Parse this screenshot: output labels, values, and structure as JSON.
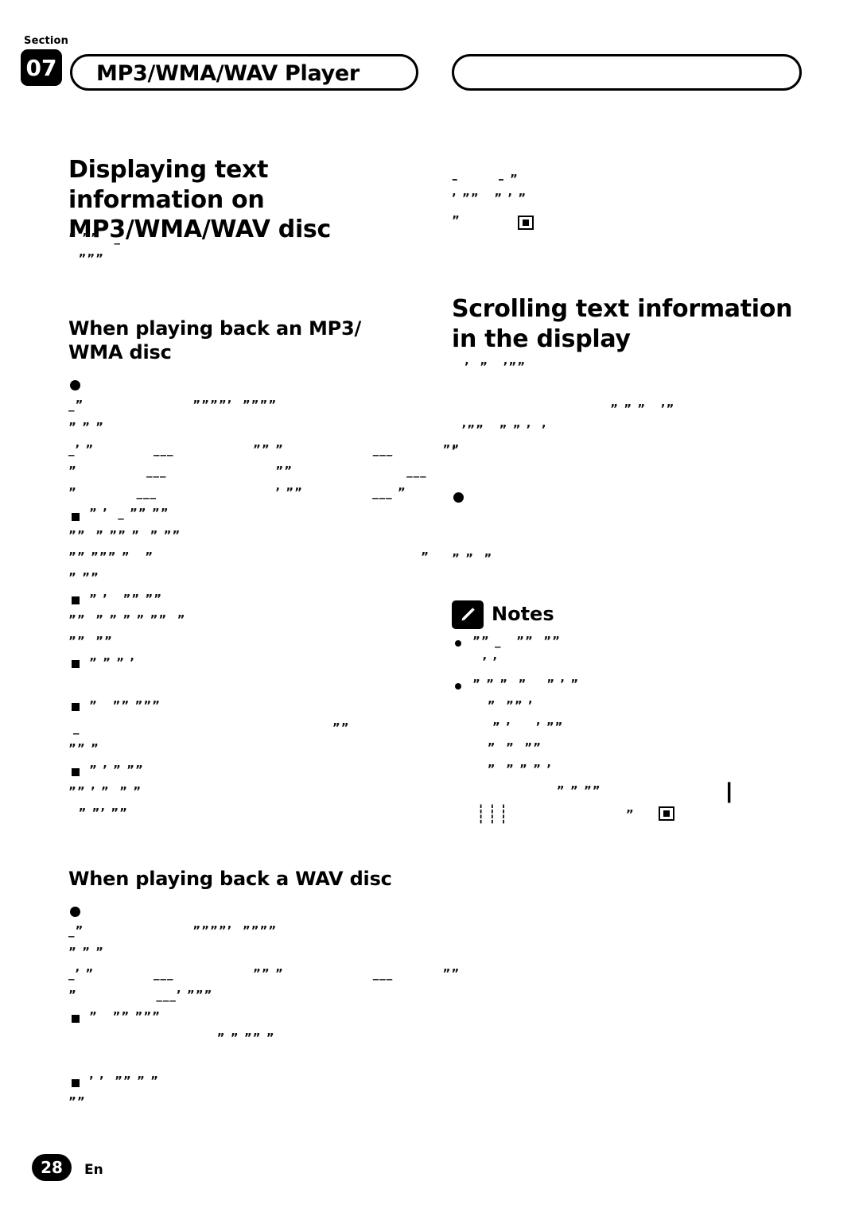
{
  "page": {
    "section_label": "Section",
    "section_number": "07",
    "chapter_title": "MP3/WMA/WAV Player",
    "page_number": "28",
    "language_code": "En"
  },
  "left_column": {
    "heading": "Displaying text information on MP3/WMA/WAV disc",
    "intro_lines": [
      "” ””   _",
      "  ”””"
    ],
    "subheading_1": "When playing back an MP3/ WMA disc",
    "body_1": [
      "_”                      ””””’  ””””",
      "” ” ”",
      "_’ ”            ___                ”” ”                  ___          ””",
      "”              ___                      ””                       ___",
      "”            ___                        ’ ””              ___ ”"
    ],
    "body_2": [
      "” ’  _ ”” ””",
      "””  ” ”” ”  ” ””",
      "”” ””” ”   ”                                                      ”",
      "” ””"
    ],
    "body_3": [
      "” ’   ”” ””",
      "””  ” ” ” ” ””  ”",
      "””  ””"
    ],
    "body_4": [
      "” ” ” ’"
    ],
    "body_5": [
      "”   ”” ”””",
      "_                                                   ””",
      "”” ”"
    ],
    "body_6": [
      "” ’ ” ””",
      "”” ’ ”  ” ”",
      "  ” ”’ ””"
    ],
    "subheading_2": "When playing back a WAV disc",
    "body_7": [
      "_”                      ””””’  ””””",
      "” ” ”",
      "_’ ”            ___                ”” ”                  ___          ””",
      "”                ___’ ”””"
    ],
    "body_8": [
      "”   ”” ”””",
      "                              ” ” ”” ”"
    ],
    "body_9": [
      "’ ’  ”” ” ”",
      "””"
    ]
  },
  "right_column": {
    "top_lines": [
      "–        – ”",
      "’ ””   ” ’ ”",
      "”"
    ],
    "heading": "Scrolling text information in the display",
    "body_1": [
      "’  ”   ’””"
    ],
    "body_2": [
      "                                ” ” ”   ’”",
      "  ’””   ” ” ’  ’",
      "’"
    ],
    "body_3": [
      "” ”  ”"
    ],
    "notes_label": "Notes",
    "notes": [
      [
        "”” _   ””  ””",
        "  ’ ’"
      ],
      [
        "” ” ”  ”    ” ’ ”",
        "   ”  ”” ’",
        "    ” ’     ’ ””",
        "   ”  ”  ””",
        "   ”  ” ” ” ’",
        "                 ” ” ””",
        "                               ”"
      ]
    ]
  },
  "icons": {
    "pencil": "pencil-icon",
    "stop_key": "stop-key-icon",
    "bars": "bars-icon"
  }
}
